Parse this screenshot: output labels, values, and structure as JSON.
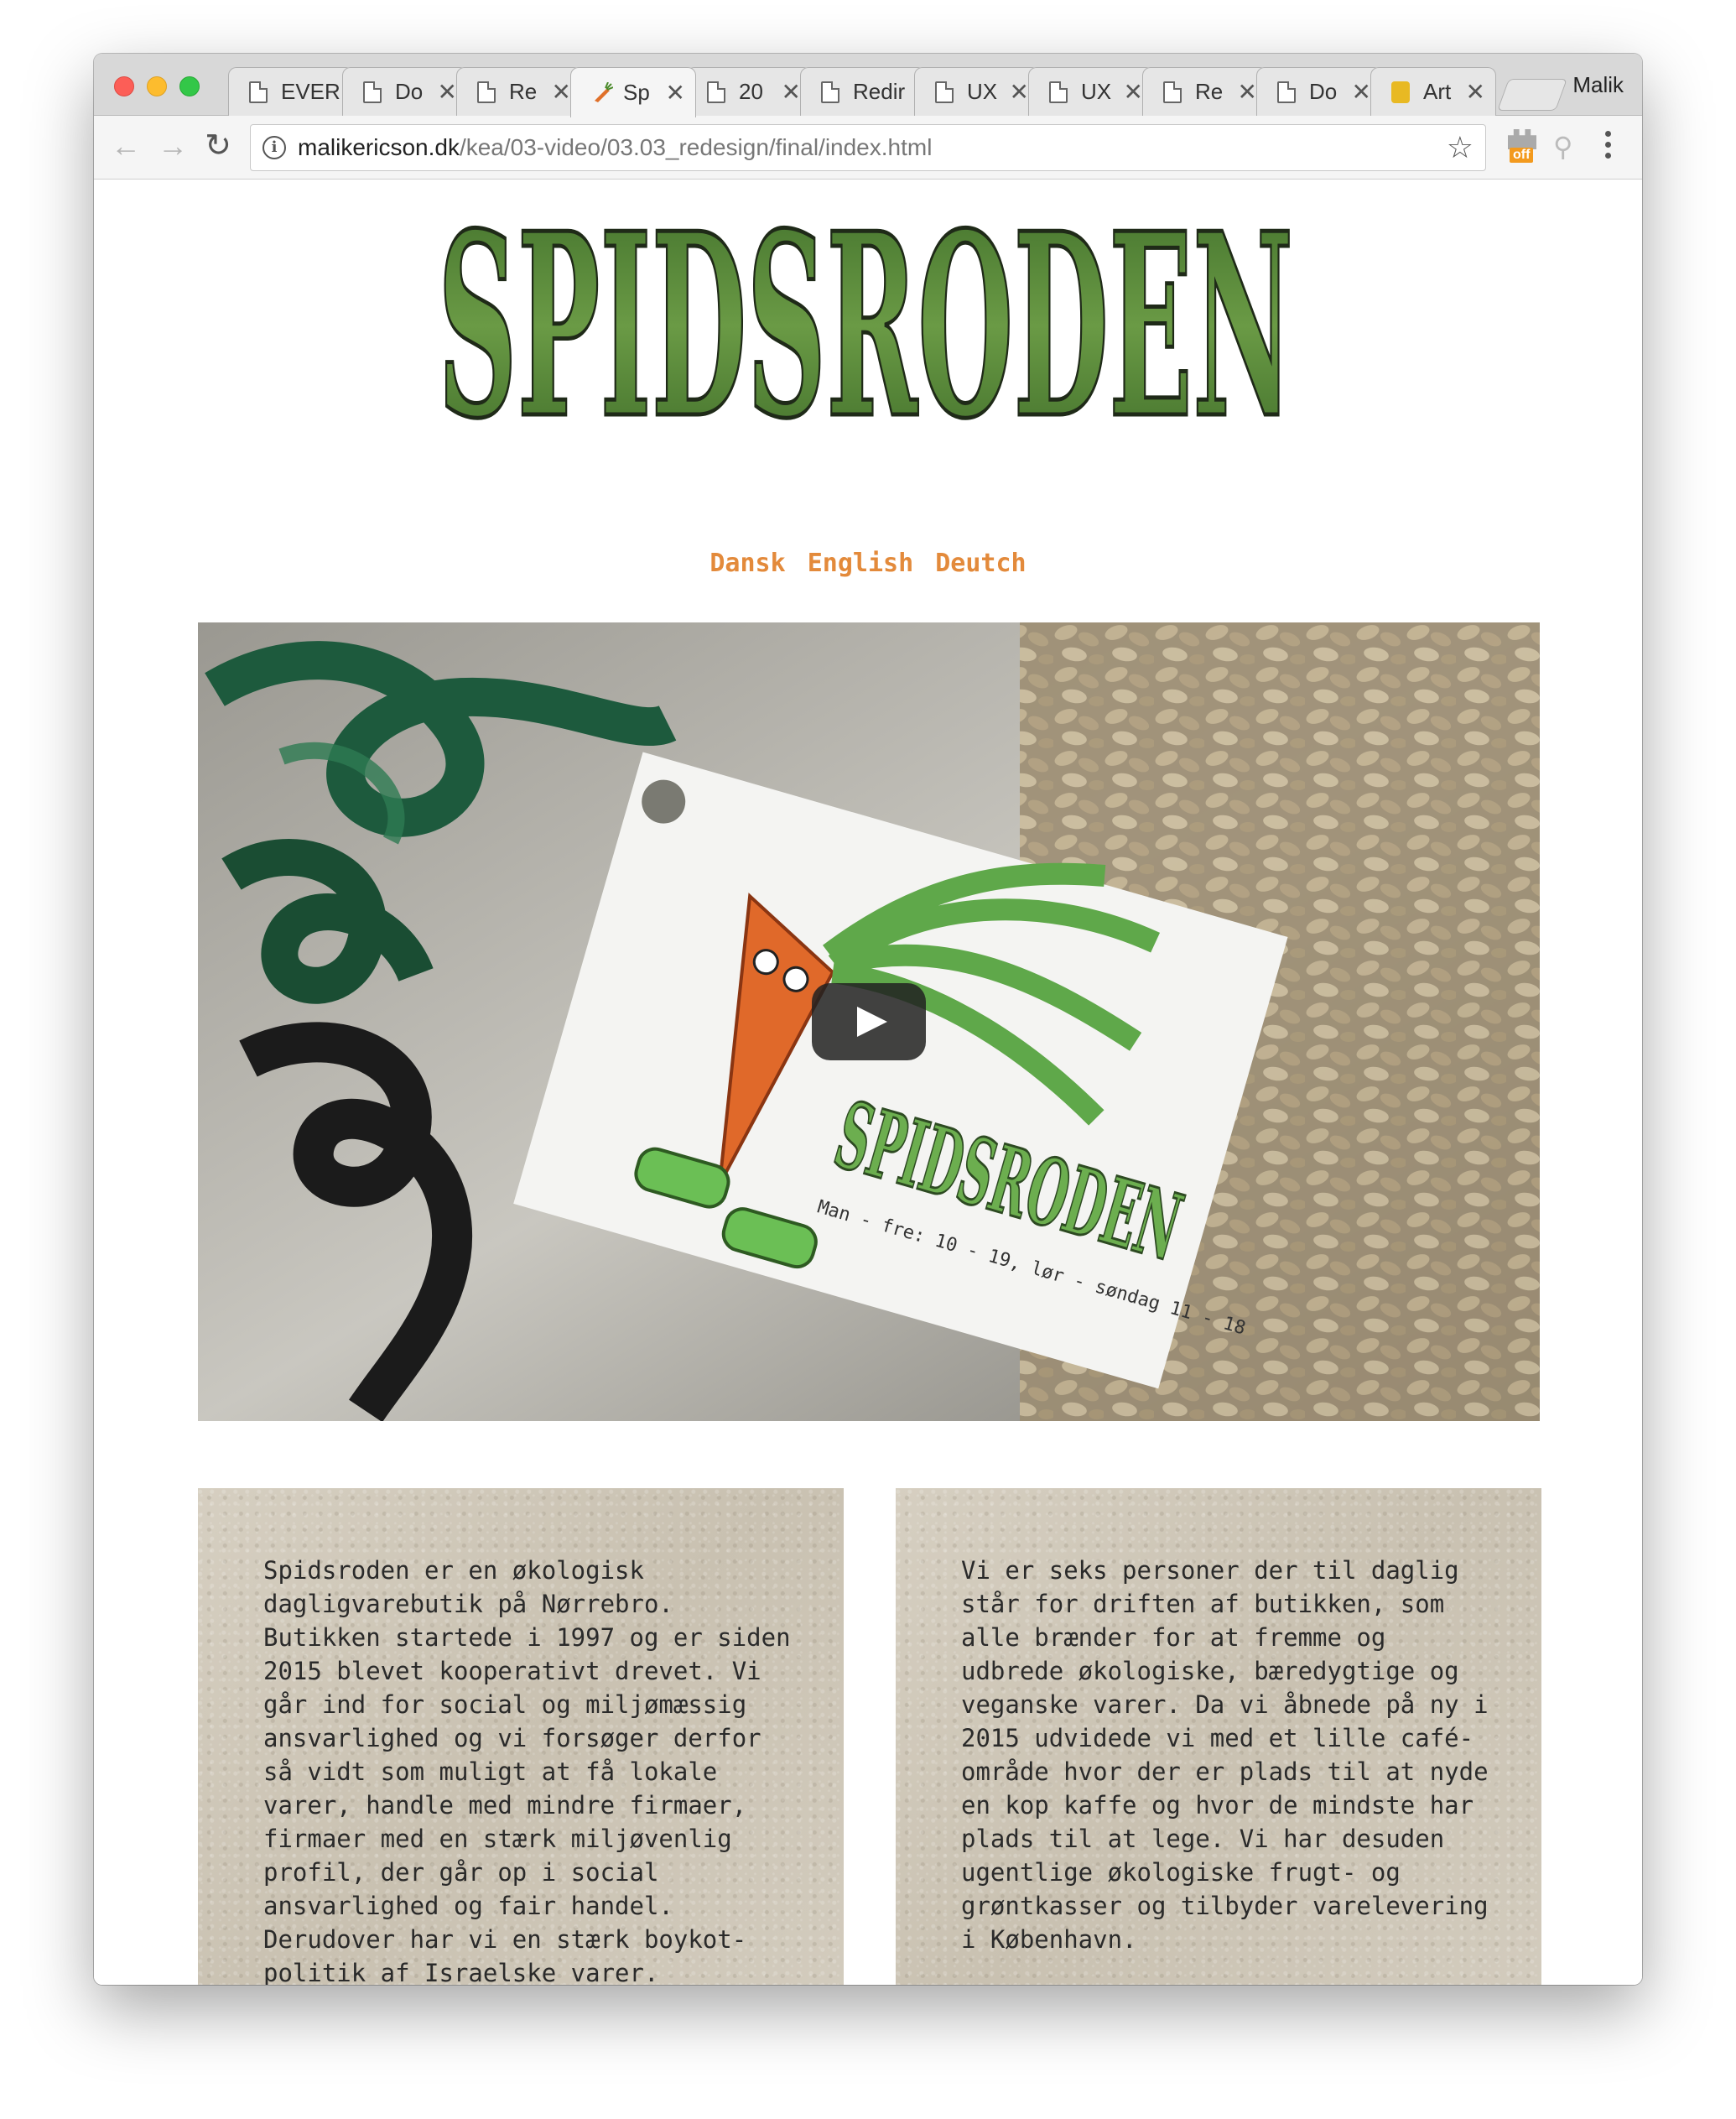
{
  "browser": {
    "tabs": [
      {
        "title": "EVER",
        "icon": "document-icon"
      },
      {
        "title": "Do",
        "icon": "document-icon"
      },
      {
        "title": "Re",
        "icon": "document-icon"
      },
      {
        "title": "Sp",
        "icon": "carrot-icon",
        "active": true
      },
      {
        "title": "20",
        "icon": "document-icon"
      },
      {
        "title": "Redir",
        "icon": "document-icon"
      },
      {
        "title": "UX",
        "icon": "document-icon"
      },
      {
        "title": "UX",
        "icon": "document-icon"
      },
      {
        "title": "Re",
        "icon": "document-icon"
      },
      {
        "title": "Do",
        "icon": "document-icon"
      },
      {
        "title": "Art",
        "icon": "gold-icon"
      }
    ],
    "close_glyph": "✕",
    "profile_name": "Malik",
    "url_host": "malikericson.dk",
    "url_path": "/kea/03-video/03.03_redesign/final/index.html",
    "extension_badge": "off"
  },
  "site": {
    "logo_text": "SPIDSRODEN",
    "languages": [
      "Dansk",
      "English",
      "Deutch"
    ],
    "video": {
      "tag_logo": "SPIDSRODEN",
      "tag_hours": "Man - fre: 10 - 19, lør - søndag 11 - 18"
    },
    "about_left": "Spidsroden er en økologisk dagligvarebutik på Nørrebro. Butikken startede i 1997 og er siden 2015 blevet kooperativt drevet. Vi går ind for social og miljømæssig ansvarlighed og vi forsøger derfor så vidt som muligt at få lokale varer, handle med mindre firmaer, firmaer med en stærk miljøvenlig profil, der går op i social ansvarlighed og fair handel. Derudover har vi en stærk boykot-politik af Israelske varer.",
    "about_right": "Vi er seks personer der til daglig står for driften af butikken, som alle brænder for at fremme og udbrede økologiske, bæredygtige og veganske varer. Da vi åbnede på ny i 2015 udvidede vi med et lille café-område hvor der er plads til at nyde en kop kaffe og hvor de mindste har plads til at lege. Vi har desuden ugentlige økologiske frugt- og grøntkasser og tilbyder varelevering i København."
  },
  "colors": {
    "logo_green": "#5a8a3a",
    "language_orange": "#e38a3b",
    "card_paper": "#cfc7b8"
  }
}
